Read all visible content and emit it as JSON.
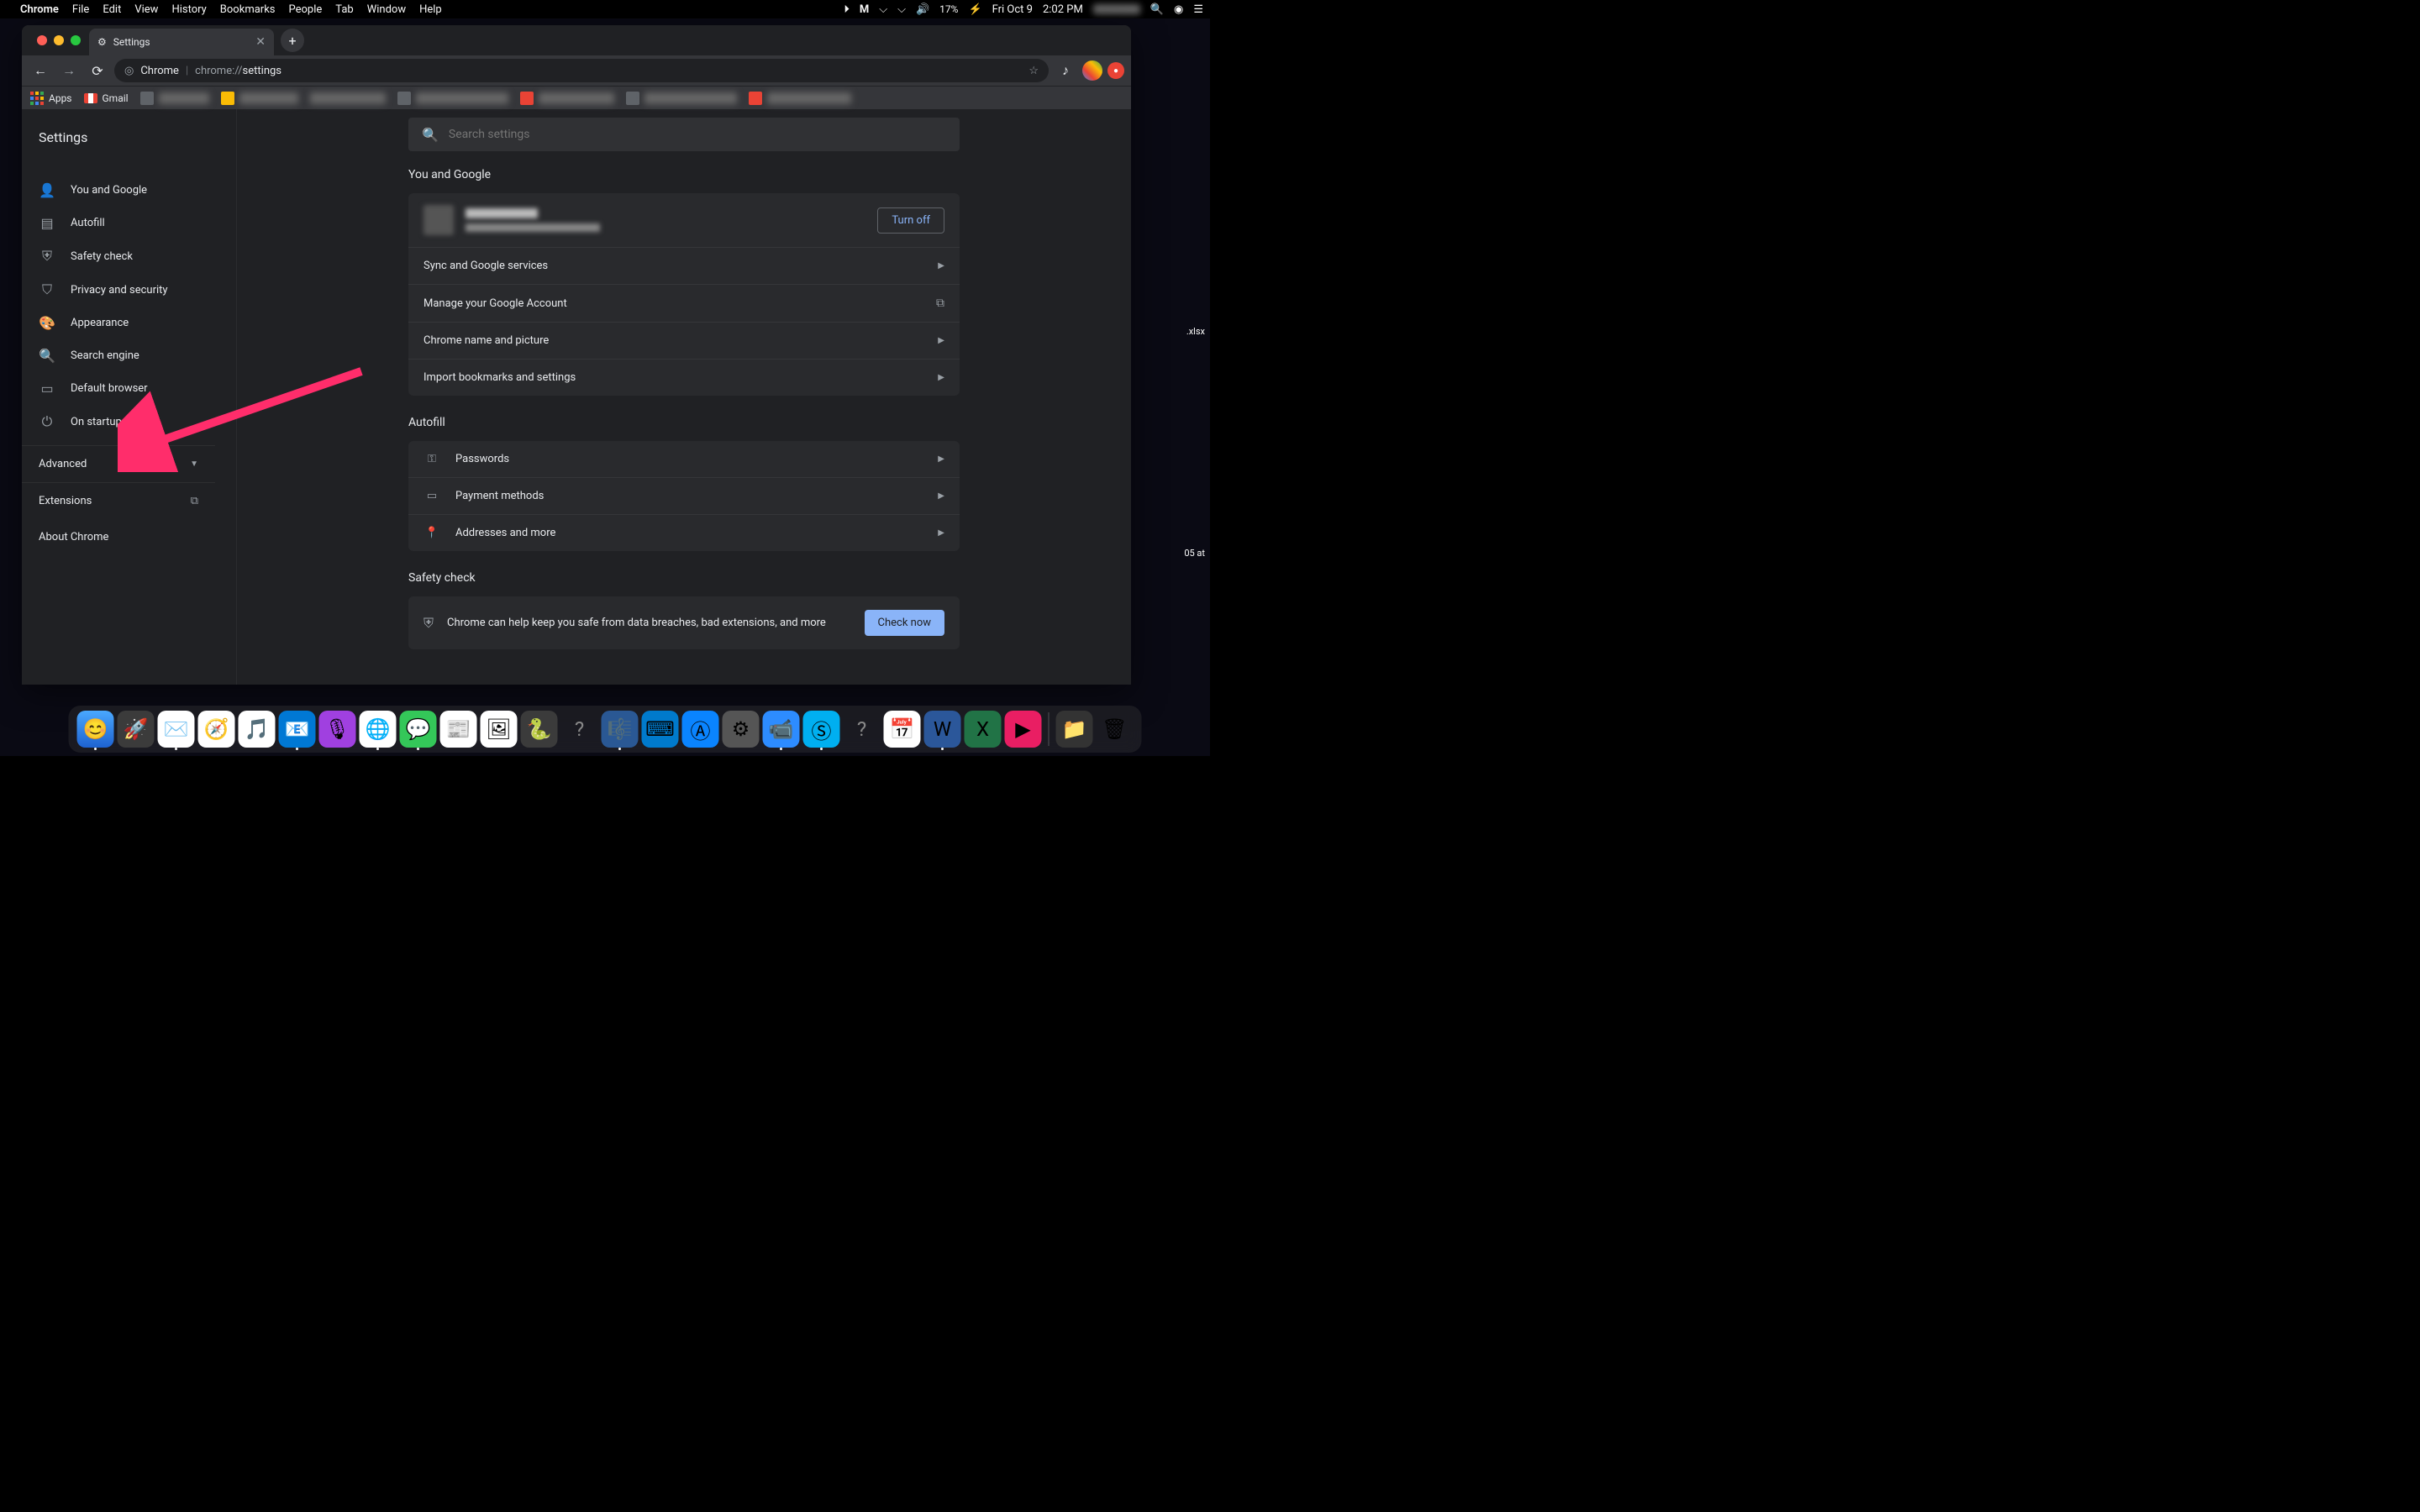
{
  "menubar": {
    "app": "Chrome",
    "items": [
      "File",
      "Edit",
      "View",
      "History",
      "Bookmarks",
      "People",
      "Tab",
      "Window",
      "Help"
    ],
    "battery": "17%",
    "date": "Fri Oct 9",
    "time": "2:02 PM"
  },
  "tab": {
    "title": "Settings"
  },
  "omnibox": {
    "host": "Chrome",
    "path": "chrome://settings"
  },
  "bookmarks": {
    "apps": "Apps",
    "gmail": "Gmail"
  },
  "sidebar": {
    "title": "Settings",
    "items": [
      {
        "label": "You and Google",
        "icon": "person"
      },
      {
        "label": "Autofill",
        "icon": "clipboard"
      },
      {
        "label": "Safety check",
        "icon": "shield-check"
      },
      {
        "label": "Privacy and security",
        "icon": "shield"
      },
      {
        "label": "Appearance",
        "icon": "palette"
      },
      {
        "label": "Search engine",
        "icon": "search"
      },
      {
        "label": "Default browser",
        "icon": "browser"
      },
      {
        "label": "On startup",
        "icon": "power"
      }
    ],
    "advanced": "Advanced",
    "extensions": "Extensions",
    "about": "About Chrome"
  },
  "search": {
    "placeholder": "Search settings"
  },
  "sections": {
    "youGoogle": {
      "title": "You and Google",
      "turnoff": "Turn off",
      "rows": [
        {
          "label": "Sync and Google services",
          "action": "chev"
        },
        {
          "label": "Manage your Google Account",
          "action": "external"
        },
        {
          "label": "Chrome name and picture",
          "action": "chev"
        },
        {
          "label": "Import bookmarks and settings",
          "action": "chev"
        }
      ]
    },
    "autofill": {
      "title": "Autofill",
      "rows": [
        {
          "label": "Passwords",
          "icon": "key"
        },
        {
          "label": "Payment methods",
          "icon": "card"
        },
        {
          "label": "Addresses and more",
          "icon": "pin"
        }
      ]
    },
    "safety": {
      "title": "Safety check",
      "desc": "Chrome can help keep you safe from data breaches, bad extensions, and more",
      "button": "Check now"
    }
  },
  "desktop": {
    "file1": ".xlsx",
    "file2": "05 at"
  },
  "colors": {
    "accent": "#8ab4f8",
    "arrow": "#ff2d6b"
  }
}
